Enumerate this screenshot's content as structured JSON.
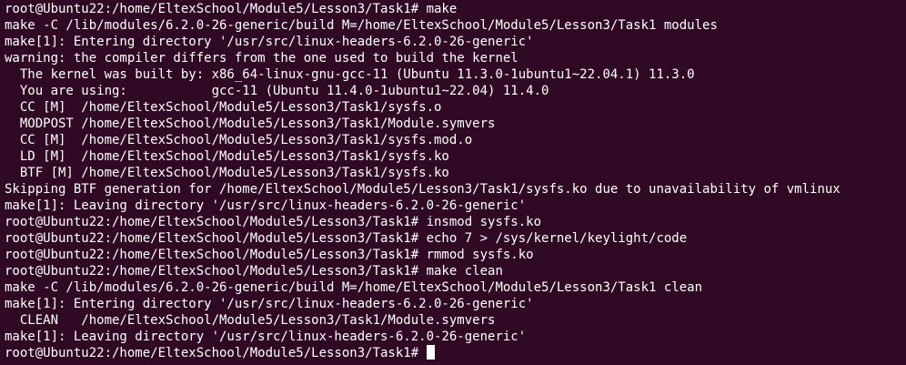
{
  "terminal": {
    "lines": [
      "root@Ubuntu22:/home/EltexSchool/Module5/Lesson3/Task1# make",
      "make -C /lib/modules/6.2.0-26-generic/build M=/home/EltexSchool/Module5/Lesson3/Task1 modules",
      "make[1]: Entering directory '/usr/src/linux-headers-6.2.0-26-generic'",
      "warning: the compiler differs from the one used to build the kernel",
      "  The kernel was built by: x86_64-linux-gnu-gcc-11 (Ubuntu 11.3.0-1ubuntu1~22.04.1) 11.3.0",
      "  You are using:           gcc-11 (Ubuntu 11.4.0-1ubuntu1~22.04) 11.4.0",
      "  CC [M]  /home/EltexSchool/Module5/Lesson3/Task1/sysfs.o",
      "  MODPOST /home/EltexSchool/Module5/Lesson3/Task1/Module.symvers",
      "  CC [M]  /home/EltexSchool/Module5/Lesson3/Task1/sysfs.mod.o",
      "  LD [M]  /home/EltexSchool/Module5/Lesson3/Task1/sysfs.ko",
      "  BTF [M] /home/EltexSchool/Module5/Lesson3/Task1/sysfs.ko",
      "Skipping BTF generation for /home/EltexSchool/Module5/Lesson3/Task1/sysfs.ko due to unavailability of vmlinux",
      "make[1]: Leaving directory '/usr/src/linux-headers-6.2.0-26-generic'",
      "root@Ubuntu22:/home/EltexSchool/Module5/Lesson3/Task1# insmod sysfs.ko",
      "root@Ubuntu22:/home/EltexSchool/Module5/Lesson3/Task1# echo 7 > /sys/kernel/keylight/code",
      "root@Ubuntu22:/home/EltexSchool/Module5/Lesson3/Task1# rmmod sysfs.ko",
      "root@Ubuntu22:/home/EltexSchool/Module5/Lesson3/Task1# make clean",
      "make -C /lib/modules/6.2.0-26-generic/build M=/home/EltexSchool/Module5/Lesson3/Task1 clean",
      "make[1]: Entering directory '/usr/src/linux-headers-6.2.0-26-generic'",
      "  CLEAN   /home/EltexSchool/Module5/Lesson3/Task1/Module.symvers",
      "make[1]: Leaving directory '/usr/src/linux-headers-6.2.0-26-generic'"
    ],
    "prompt": "root@Ubuntu22:/home/EltexSchool/Module5/Lesson3/Task1# "
  },
  "colors": {
    "background": "#300a24",
    "foreground": "#ffffff"
  }
}
